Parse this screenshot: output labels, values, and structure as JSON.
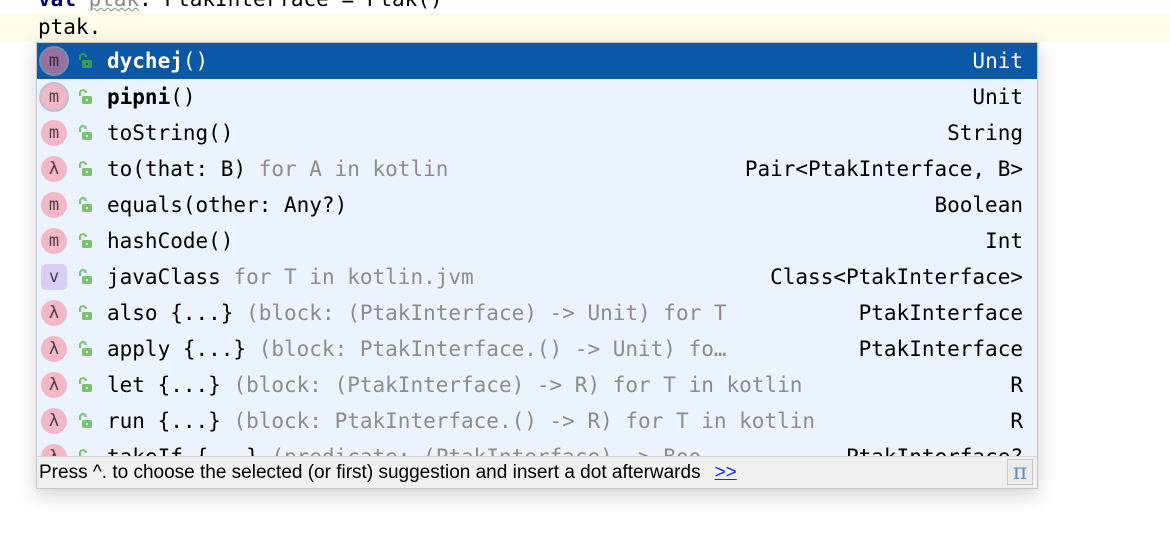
{
  "editor": {
    "previous_line": {
      "keyword": "val",
      "variable": "ptak",
      "rest": ": PtakInterface = Ptak()"
    },
    "current_line": "ptak."
  },
  "completion": {
    "items": [
      {
        "kind": "method",
        "kind_glyph": "m",
        "visibility_icon": "unlock-icon",
        "name": "dychej",
        "name_bold": true,
        "params": "()",
        "tail": "",
        "type": "Unit",
        "selected": true
      },
      {
        "kind": "method",
        "kind_glyph": "m",
        "visibility_icon": "unlock-icon",
        "name": "pipni",
        "name_bold": true,
        "params": "()",
        "tail": "",
        "type": "Unit",
        "selected": false
      },
      {
        "kind": "method",
        "kind_glyph": "m",
        "visibility_icon": "unlock-icon",
        "name": "toString",
        "name_bold": false,
        "params": "()",
        "tail": "",
        "type": "String",
        "selected": false
      },
      {
        "kind": "lambda",
        "kind_glyph": "λ",
        "visibility_icon": "unlock-icon",
        "name": "to",
        "name_bold": false,
        "params": "(that: B)",
        "tail": " for A in kotlin",
        "type": "Pair<PtakInterface, B>",
        "selected": false
      },
      {
        "kind": "method",
        "kind_glyph": "m",
        "visibility_icon": "unlock-icon",
        "name": "equals",
        "name_bold": false,
        "params": "(other: Any?)",
        "tail": "",
        "type": "Boolean",
        "selected": false
      },
      {
        "kind": "method",
        "kind_glyph": "m",
        "visibility_icon": "unlock-icon",
        "name": "hashCode",
        "name_bold": false,
        "params": "()",
        "tail": "",
        "type": "Int",
        "selected": false
      },
      {
        "kind": "var",
        "kind_glyph": "v",
        "visibility_icon": "unlock-icon",
        "name": "javaClass",
        "name_bold": false,
        "params": "",
        "tail": " for T in kotlin.jvm",
        "type": "Class<PtakInterface>",
        "selected": false
      },
      {
        "kind": "lambda",
        "kind_glyph": "λ",
        "visibility_icon": "unlock-icon",
        "name": "also",
        "name_bold": false,
        "params": " {...}",
        "tail": " (block: (PtakInterface) -> Unit) for T",
        "type": "PtakInterface",
        "selected": false
      },
      {
        "kind": "lambda",
        "kind_glyph": "λ",
        "visibility_icon": "unlock-icon",
        "name": "apply",
        "name_bold": false,
        "params": " {...}",
        "tail": " (block: PtakInterface.() -> Unit) fo…",
        "type": "PtakInterface",
        "selected": false
      },
      {
        "kind": "lambda",
        "kind_glyph": "λ",
        "visibility_icon": "unlock-icon",
        "name": "let",
        "name_bold": false,
        "params": " {...}",
        "tail": " (block: (PtakInterface) -> R) for T in kotlin",
        "type": "R",
        "selected": false
      },
      {
        "kind": "lambda",
        "kind_glyph": "λ",
        "visibility_icon": "unlock-icon",
        "name": "run",
        "name_bold": false,
        "params": " {...}",
        "tail": " (block: PtakInterface.() -> R) for T in kotlin",
        "type": "R",
        "selected": false
      },
      {
        "kind": "lambda",
        "kind_glyph": "λ",
        "visibility_icon": "unlock-icon",
        "name": "takeIf",
        "name_bold": false,
        "params": " {...}",
        "tail": " (predicate: (PtakInterface) -> Boo…",
        "type": "PtakInterface?",
        "selected": false
      }
    ],
    "footer": {
      "hint": "Press ^. to choose the selected (or first) suggestion and insert a dot afterwards",
      "more_link": ">>",
      "pi_button": "π"
    }
  },
  "colors": {
    "selection": "#0b57a8",
    "popup_background": "#ebf4fe",
    "method_badge": "#f2b8c6",
    "var_badge": "#d9ccf7",
    "lock_green": "#7cc46c",
    "link": "#2222ee",
    "current_line": "#fdfbe8"
  }
}
